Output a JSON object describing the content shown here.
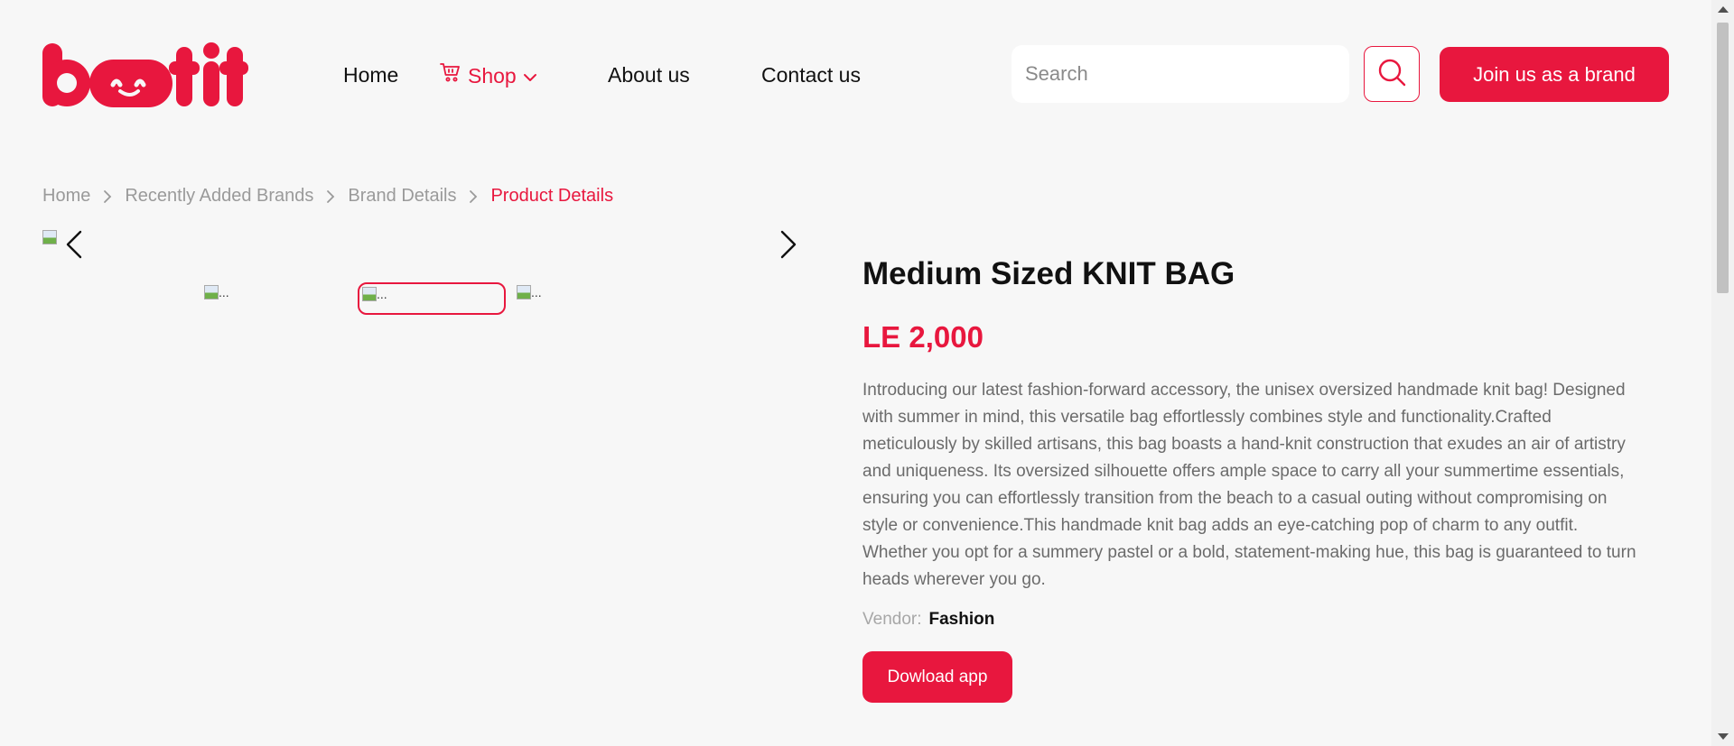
{
  "header": {
    "logo_text": "botit",
    "nav": {
      "home": "Home",
      "shop": "Shop",
      "about": "About us",
      "contact": "Contact us"
    },
    "search_placeholder": "Search",
    "join_label": "Join us as a brand"
  },
  "breadcrumb": {
    "items": [
      "Home",
      "Recently Added Brands",
      "Brand Details",
      "Product Details"
    ]
  },
  "gallery": {
    "broken_alt": "...",
    "selected_thumbnail": 2
  },
  "product": {
    "title": "Medium Sized KNIT BAG",
    "price": "LE 2,000",
    "description": "Introducing our latest fashion-forward accessory, the unisex oversized handmade knit bag! Designed with summer in mind, this versatile bag effortlessly combines style and functionality.Crafted meticulously by skilled artisans, this bag boasts a hand-knit construction that exudes an air of artistry and uniqueness. Its oversized silhouette offers ample space to carry all your summertime essentials, ensuring you can effortlessly transition from the beach to a casual outing without compromising on style or convenience.This handmade knit bag adds an eye-catching pop of charm to any outfit. Whether you opt for a summery pastel or a bold, statement-making hue, this bag is guaranteed to turn heads wherever you go.",
    "vendor_label": "Vendor:",
    "vendor_value": "Fashion",
    "download_label": "Dowload app"
  },
  "colors": {
    "accent": "#e8173e",
    "background": "#f7f7f7"
  },
  "icons": {
    "cart": "cart-icon",
    "chevron": "chevron-down-icon",
    "search": "search-icon",
    "prev": "chevron-left-icon",
    "next": "chevron-right-icon",
    "crumb_separator": "chevron-right-icon"
  }
}
